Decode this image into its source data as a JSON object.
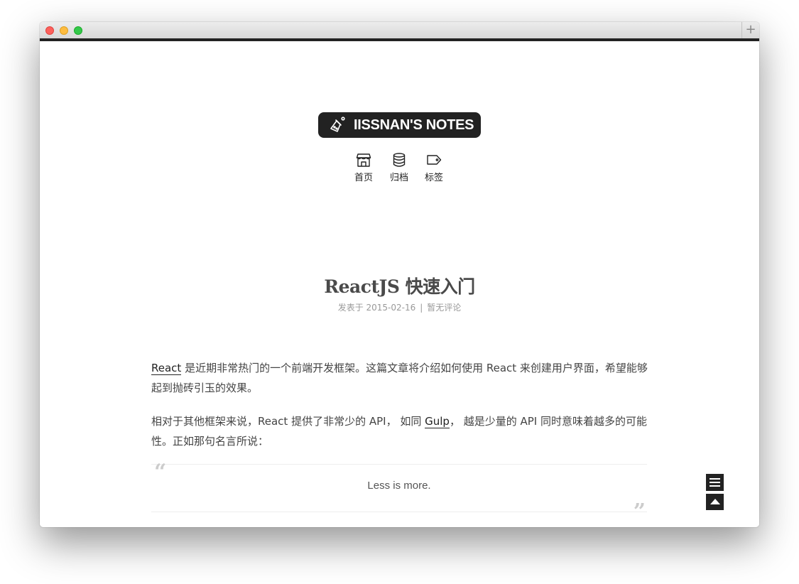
{
  "window": {
    "new_tab_symbol": "+"
  },
  "site": {
    "brand_title": "IISSNAN'S NOTES",
    "brand_icon": "flask-icon"
  },
  "nav": {
    "items": [
      {
        "label": "首页",
        "icon": "store-icon"
      },
      {
        "label": "归档",
        "icon": "database-icon"
      },
      {
        "label": "标签",
        "icon": "tag-icon"
      }
    ]
  },
  "post": {
    "title": "ReactJS 快速入门",
    "meta_date": "发表于 2015-02-16",
    "meta_separator": "|",
    "meta_comments": "暂无评论",
    "p1_link": "React",
    "p1_text": " 是近期非常热门的一个前端开发框架。这篇文章将介绍如何使用 React 来创建用户界面，希望能够起到抛砖引玉的效果。",
    "p2_text_a": "相对于其他框架来说，React 提供了非常少的 API， 如同 ",
    "p2_link": "Gulp",
    "p2_text_b": "， 越是少量的 API 同时意味着越多的可能性。正如那句名言所说：",
    "quote": "Less is more.",
    "quote_open_mark": "“",
    "quote_close_mark": "”"
  },
  "floating": {
    "menu_icon": "menu-icon",
    "back_to_top_icon": "arrow-up-icon"
  },
  "colors": {
    "dark": "#222222",
    "text": "#444444",
    "meta": "#999999"
  }
}
